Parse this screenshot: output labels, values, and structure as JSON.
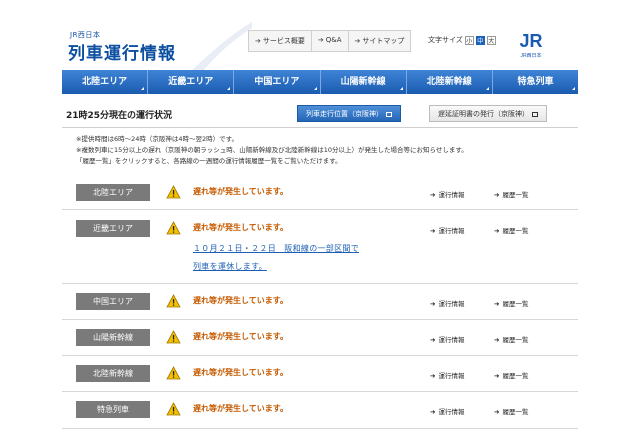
{
  "header": {
    "company": "JR西日本",
    "title": "列車運行情報",
    "topnav": [
      {
        "label": "サービス概要"
      },
      {
        "label": "Q&A"
      },
      {
        "label": "サイトマップ"
      }
    ],
    "font_size_label": "文字サイズ",
    "font_sizes": [
      {
        "label": "小"
      },
      {
        "label": "中",
        "active": true
      },
      {
        "label": "大"
      }
    ],
    "logo_text": "JR",
    "logo_caption": "JR西日本",
    "brand_color": "#1a5bb0"
  },
  "mainnav": [
    {
      "label": "北陸エリア"
    },
    {
      "label": "近畿エリア"
    },
    {
      "label": "中国エリア"
    },
    {
      "label": "山陽新幹線"
    },
    {
      "label": "北陸新幹線"
    },
    {
      "label": "特急列車"
    }
  ],
  "status": {
    "title": "21時25分現在の運行状況",
    "button_position": "列車走行位置（京阪神）",
    "button_certificate": "遅延証明書の発行（京阪神）"
  },
  "notes": [
    "※提供時間は6時～24時（京阪神は4時～翌2時）です。",
    "※複数列車に15分以上の遅れ（京阪神の朝ラッシュ時、山陽新幹線及び北陸新幹線は10分以上）が発生した場合等にお知らせします。",
    "「履歴一覧」をクリックすると、各路線の一週間の運行情報履歴一覧をご覧いただけます。"
  ],
  "rows": [
    {
      "area": "北陸エリア",
      "status": "遅れ等が発生しています。",
      "info": "運行情報",
      "history": "履歴一覧"
    },
    {
      "area": "近畿エリア",
      "status": "遅れ等が発生しています。",
      "info": "運行情報",
      "history": "履歴一覧",
      "detail_lines": [
        "１０月２１日・２２日　阪和線の一部区間で",
        "列車を運休します。"
      ]
    },
    {
      "area": "中国エリア",
      "status": "遅れ等が発生しています。",
      "info": "運行情報",
      "history": "履歴一覧"
    },
    {
      "area": "山陽新幹線",
      "status": "遅れ等が発生しています。",
      "info": "運行情報",
      "history": "履歴一覧"
    },
    {
      "area": "北陸新幹線",
      "status": "遅れ等が発生しています。",
      "info": "運行情報",
      "history": "履歴一覧"
    },
    {
      "area": "特急列車",
      "status": "遅れ等が発生しています。",
      "info": "運行情報",
      "history": "履歴一覧"
    }
  ],
  "colors": {
    "nav_blue": "#1a5bb0",
    "badge_gray": "#7a7a7a",
    "warning_orange": "#c65a00",
    "link_blue": "#1d5fb5",
    "warning_yellow": "#f3c000"
  },
  "icons": {
    "warning": "warning-triangle-icon",
    "arrow": "arrow-right-icon",
    "external": "external-window-icon"
  }
}
